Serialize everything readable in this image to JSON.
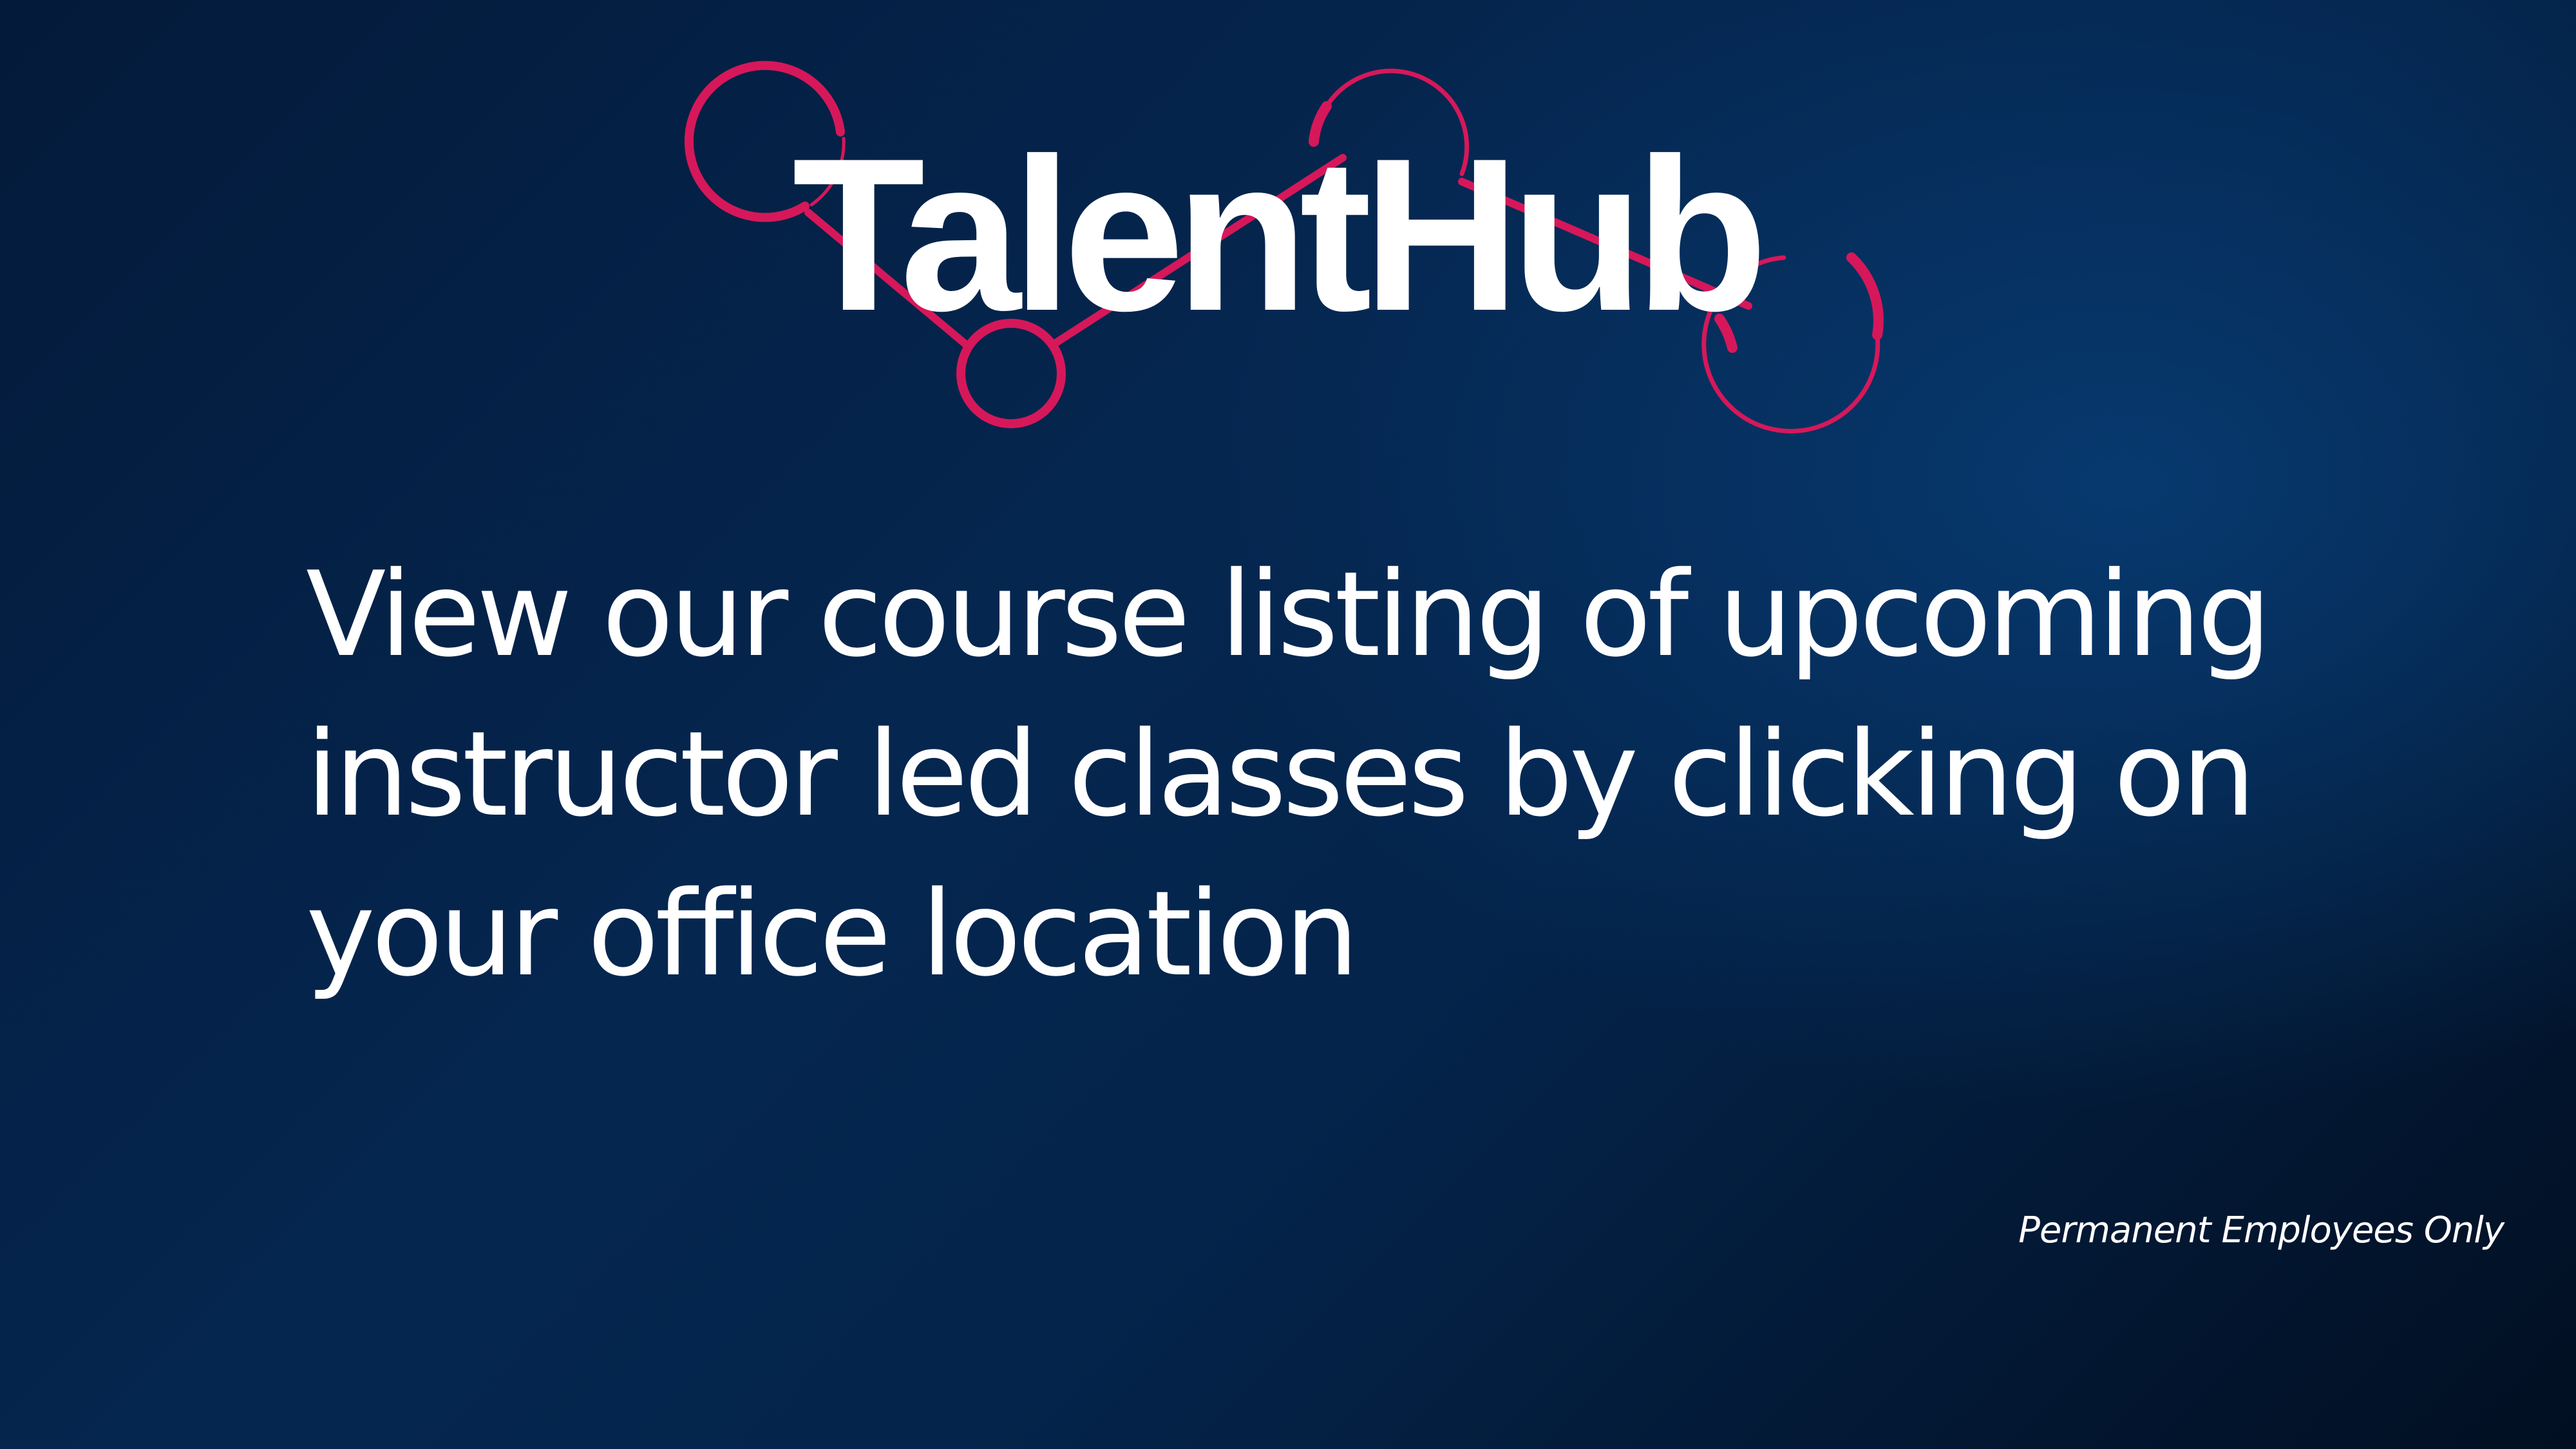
{
  "brand": {
    "name": "TalentHub",
    "accent_color": "#d6185a"
  },
  "headline": {
    "lines": [
      "View our course listing of upcoming",
      "instructor led classes by clicking on",
      "your office location"
    ]
  },
  "footnote": "Permanent Employees Only"
}
